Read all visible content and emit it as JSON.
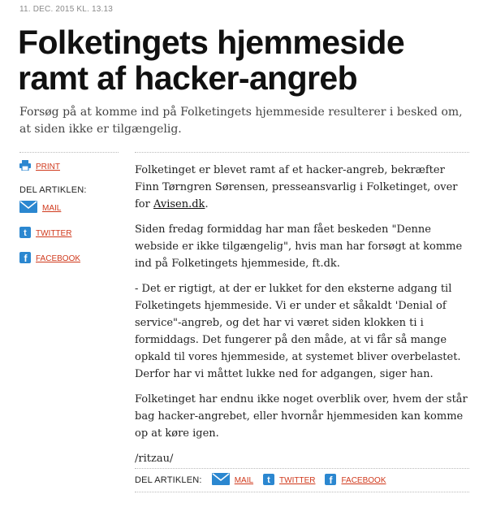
{
  "article": {
    "dateline": "11. DEC. 2015 KL. 13.13",
    "headline": "Folketingets hjemmeside ramt af hacker-angreb",
    "lead": "Forsøg på at komme ind på Folketingets hjemmeside resulterer i besked om, at siden ikke er tilgængelig.",
    "paragraphs": {
      "p1_before": "Folketinget er blevet ramt af et hacker-angreb, bekræfter Finn Tørngren Sørensen, presseansvarlig i Folketinget, over for ",
      "p1_link": "Avisen.dk",
      "p1_after": ".",
      "p2": "Siden fredag formiddag har man fået beskeden \"Denne webside er ikke tilgængelig\", hvis man har forsøgt at komme ind på Folketingets hjemmeside, ft.dk.",
      "p3": "- Det er rigtigt, at der er lukket for den eksterne adgang til Folketingets hjemmeside. Vi er under et såkaldt 'Denial of service\"-angreb, og det har vi været siden klokken ti i formiddags. Det fungerer på den måde, at vi får så mange opkald til vores hjemmeside, at systemet bliver overbelastet. Derfor har vi måttet lukke ned for adgangen, siger han.",
      "p4": "Folketinget har endnu ikke noget overblik over, hvem der står bag hacker-angrebet, eller hvornår hjemmesiden kan komme op at køre igen.",
      "p5": "/ritzau/"
    }
  },
  "sidebar": {
    "print_label": "PRINT",
    "share_heading": "DEL ARTIKLEN:",
    "mail_label": "MAIL",
    "twitter_label": "TWITTER",
    "facebook_label": "FACEBOOK"
  },
  "bottom_share": {
    "heading": "DEL ARTIKLEN:",
    "mail_label": "MAIL",
    "twitter_label": "TWITTER",
    "facebook_label": "FACEBOOK"
  },
  "colors": {
    "link_red": "#d0391c",
    "icon_blue": "#2b87d0",
    "text": "#111111",
    "lead_gray": "#444444",
    "date_gray": "#8a8a8a"
  },
  "icons": [
    "printer-icon",
    "mail-icon",
    "twitter-icon",
    "facebook-icon"
  ]
}
